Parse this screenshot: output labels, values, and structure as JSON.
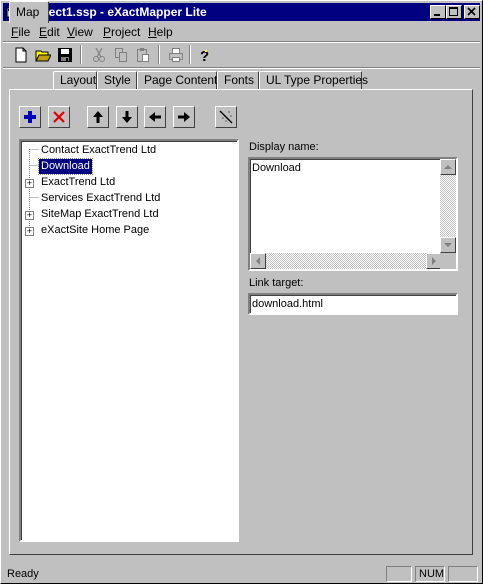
{
  "window": {
    "title": "project1.ssp - eXactMapper Lite",
    "controls": [
      "minimize-icon",
      "maximize-icon",
      "close-icon"
    ]
  },
  "menu": {
    "items": [
      {
        "label": "File",
        "mnemonic": "F"
      },
      {
        "label": "Edit",
        "mnemonic": "E"
      },
      {
        "label": "View",
        "mnemonic": "V"
      },
      {
        "label": "Project",
        "mnemonic": "P"
      },
      {
        "label": "Help",
        "mnemonic": "H"
      }
    ]
  },
  "toolbar": {
    "icons": [
      "new-file-icon",
      "open-folder-icon",
      "save-icon",
      "cut-icon",
      "copy-icon",
      "paste-icon",
      "print-icon",
      "help-icon"
    ]
  },
  "tabs": [
    {
      "label": "Map",
      "active": true
    },
    {
      "label": "Layout",
      "active": false
    },
    {
      "label": "Style",
      "active": false
    },
    {
      "label": "Page Content",
      "active": false
    },
    {
      "label": "Fonts",
      "active": false
    },
    {
      "label": "UL Type Properties",
      "active": false
    }
  ],
  "map_actions": {
    "icons": [
      "add-icon",
      "delete-icon",
      "move-up-icon",
      "move-down-icon",
      "move-left-icon",
      "move-right-icon",
      "wand-icon"
    ]
  },
  "tree": {
    "items": [
      {
        "label": "Contact ExactTrend Ltd",
        "expandable": false,
        "selected": false
      },
      {
        "label": "Download",
        "expandable": false,
        "selected": true
      },
      {
        "label": "ExactTrend Ltd",
        "expandable": true,
        "selected": false
      },
      {
        "label": "Services ExactTrend Ltd",
        "expandable": false,
        "selected": false
      },
      {
        "label": "SiteMap ExactTrend Ltd",
        "expandable": true,
        "selected": false
      },
      {
        "label": "eXactSite Home Page",
        "expandable": true,
        "selected": false
      }
    ]
  },
  "display_name": {
    "label": "Display name:",
    "value": "Download"
  },
  "link_target": {
    "label": "Link target:",
    "value": "download.html"
  },
  "status": {
    "text": "Ready",
    "num": "NUM"
  },
  "colors": {
    "titlebar": "#000080",
    "face": "#c0c0c0",
    "selection": "#000080",
    "add_icon": "#0000c0",
    "delete_icon": "#e00000"
  }
}
